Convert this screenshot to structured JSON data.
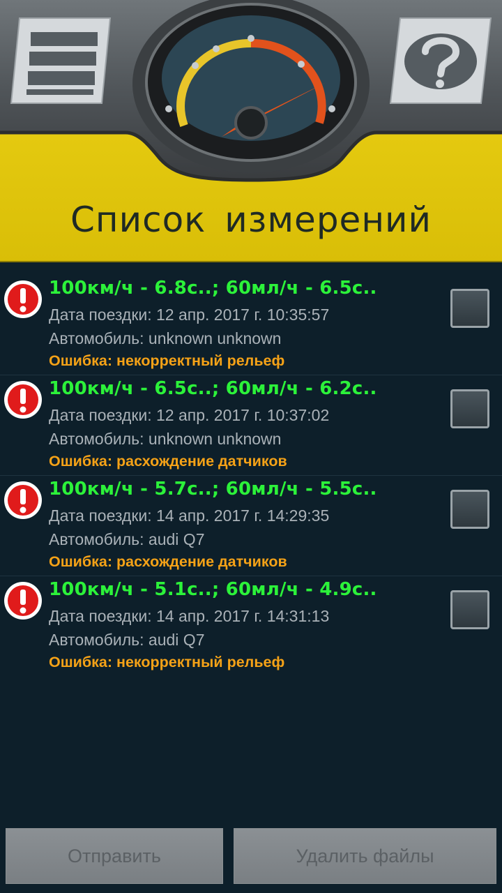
{
  "header": {
    "title": "Список измерений",
    "menu_icon": "list-menu-icon",
    "help_icon": "help-question-icon",
    "gauge_icon": "speedometer-gauge-icon",
    "colors": {
      "yellow": "#e2c60e",
      "dark_top": "#5a5e60"
    }
  },
  "measurements": [
    {
      "summary": "100км/ч - 6.8с..; 60мл/ч - 6.5с..",
      "date": "Дата поездки: 12 апр. 2017 г. 10:35:57",
      "car": "Автомобиль: unknown unknown",
      "error": "Ошибка: некорректный рельеф",
      "checked": false
    },
    {
      "summary": "100км/ч - 6.5с..; 60мл/ч - 6.2с..",
      "date": "Дата поездки: 12 апр. 2017 г. 10:37:02",
      "car": "Автомобиль: unknown unknown",
      "error": "Ошибка: расхождение датчиков",
      "checked": false
    },
    {
      "summary": "100км/ч - 5.7с..; 60мл/ч - 5.5с..",
      "date": "Дата поездки: 14 апр. 2017 г. 14:29:35",
      "car": "Автомобиль: audi Q7",
      "error": "Ошибка: расхождение датчиков",
      "checked": false
    },
    {
      "summary": "100км/ч - 5.1с..; 60мл/ч - 4.9с..",
      "date": "Дата поездки: 14 апр. 2017 г. 14:31:13",
      "car": "Автомобиль: audi Q7",
      "error": "Ошибка: некорректный рельеф",
      "checked": false
    }
  ],
  "status_icon": "error-exclamation-icon",
  "buttons": {
    "send_label": "Отправить",
    "delete_label": "Удалить файлы"
  },
  "colors": {
    "background": "#0d1f2a",
    "summary_green": "#2cf23a",
    "error_orange": "#f5a217",
    "detail_gray": "#aab2b8"
  }
}
